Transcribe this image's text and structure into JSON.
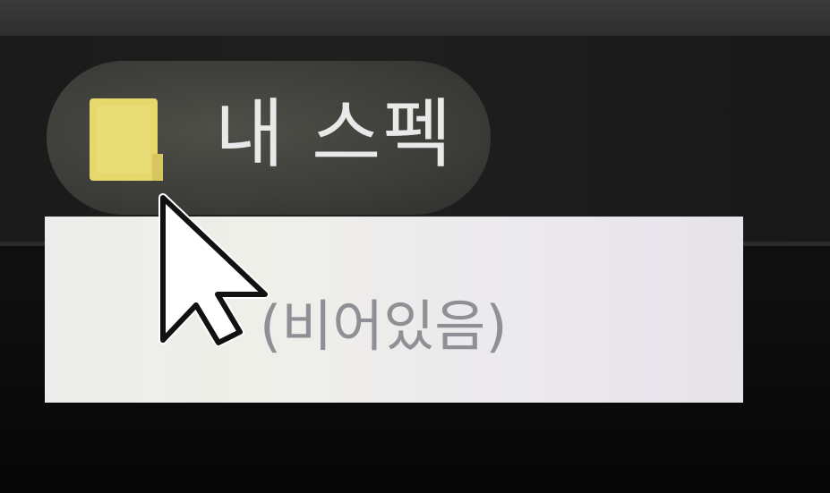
{
  "taskbar": {
    "folder_button": {
      "label": "내 스펙",
      "icon": "folder-icon",
      "icon_color": "#e7d86c"
    }
  },
  "jumplist": {
    "empty_text": "(비어있음)"
  },
  "cursor": {
    "icon": "mouse-pointer-icon"
  }
}
